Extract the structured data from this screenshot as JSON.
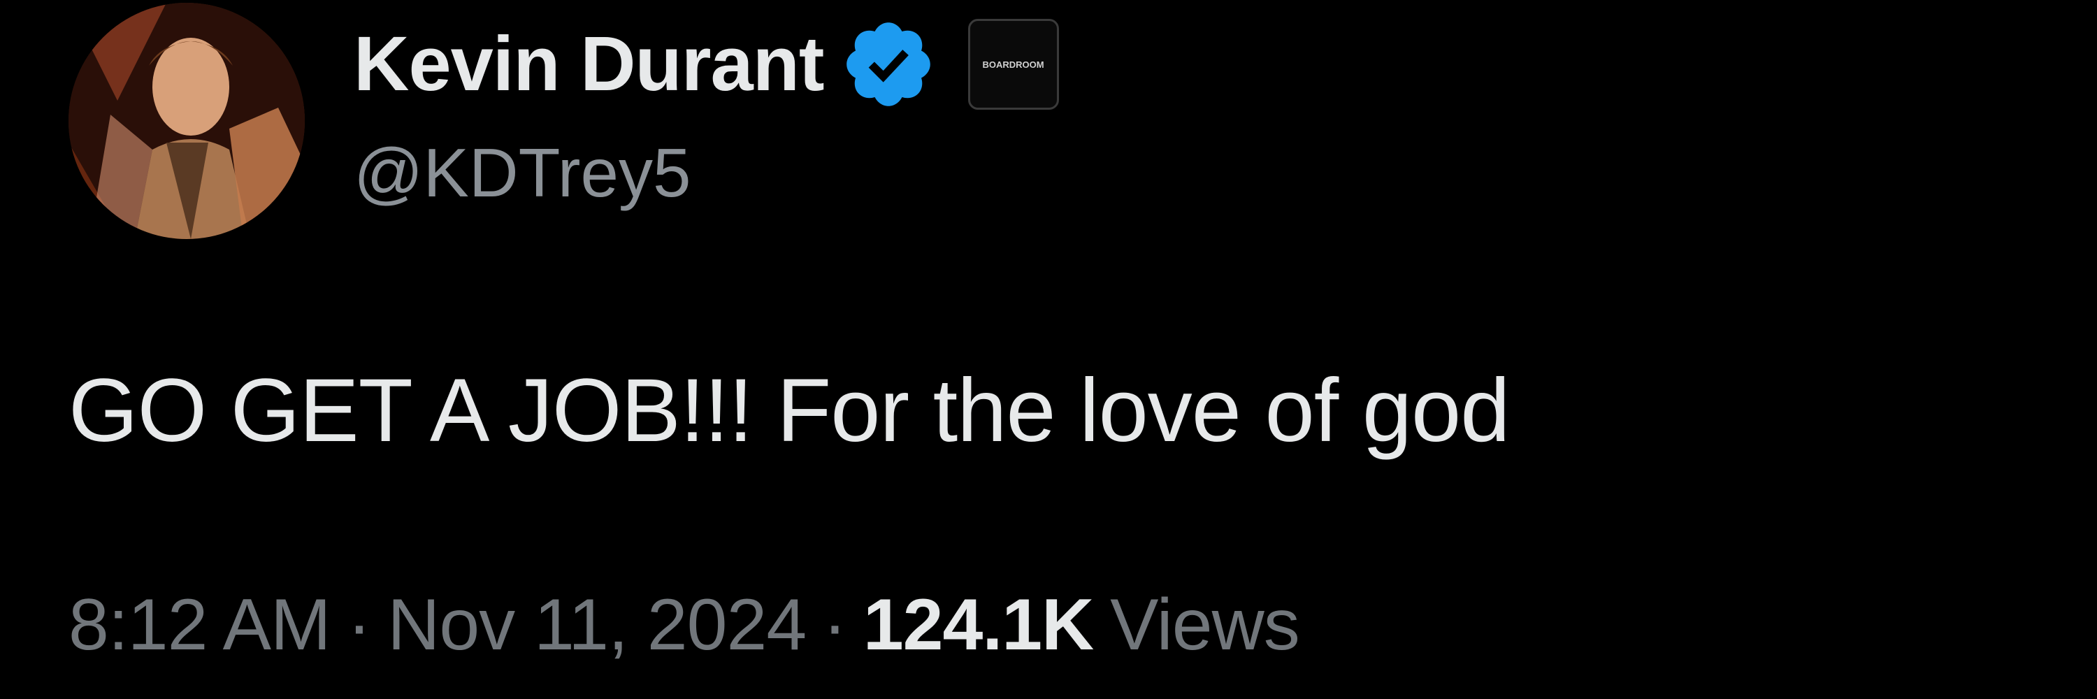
{
  "tweet": {
    "author": {
      "display_name": "Kevin Durant",
      "handle": "@KDTrey5",
      "verified": true,
      "affiliate_badge_text": "BOARDROOM",
      "avatar_icon": "profile-avatar"
    },
    "text": "GO GET A JOB!!! For the love of god",
    "meta": {
      "time": "8:12 AM",
      "separator": "·",
      "date": "Nov 11, 2024",
      "views_count": "124.1K",
      "views_label": "Views"
    }
  },
  "colors": {
    "background": "#000000",
    "primary_text": "#e7e9ea",
    "secondary_text": "#71767b",
    "verified_blue": "#1d9bf0"
  }
}
